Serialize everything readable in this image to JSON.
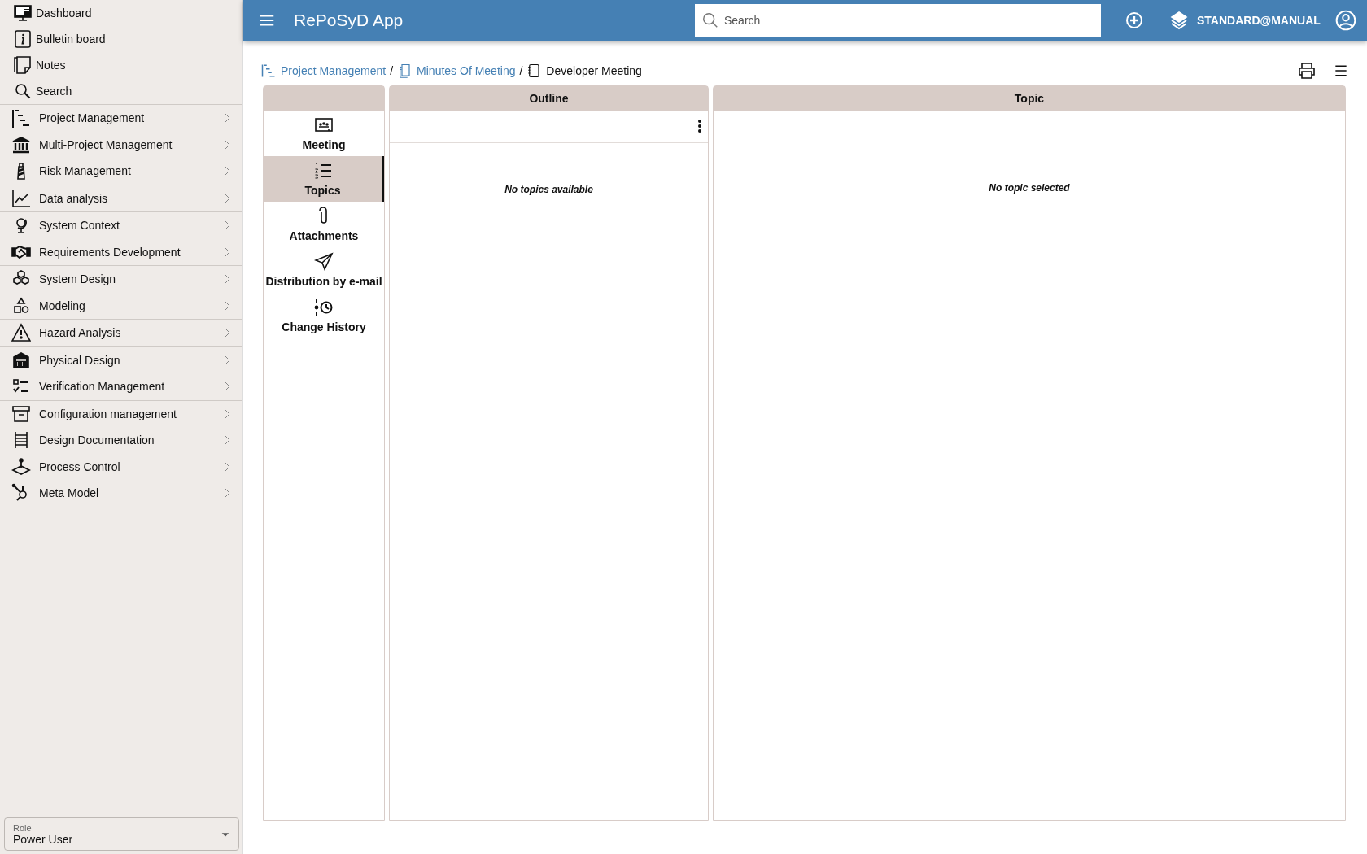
{
  "sidebar": {
    "top_items": [
      {
        "label": "Dashboard"
      },
      {
        "label": "Bulletin board"
      },
      {
        "label": "Notes"
      },
      {
        "label": "Search"
      }
    ],
    "groups": [
      [
        {
          "label": "Project Management"
        },
        {
          "label": "Multi-Project Management"
        },
        {
          "label": "Risk Management"
        }
      ],
      [
        {
          "label": "Data analysis"
        }
      ],
      [
        {
          "label": "System Context"
        },
        {
          "label": "Requirements Development"
        }
      ],
      [
        {
          "label": "System Design"
        },
        {
          "label": "Modeling"
        }
      ],
      [
        {
          "label": "Hazard Analysis"
        }
      ],
      [
        {
          "label": "Physical Design"
        },
        {
          "label": "Verification Management"
        }
      ],
      [
        {
          "label": "Configuration management"
        },
        {
          "label": "Design Documentation"
        },
        {
          "label": "Process Control"
        },
        {
          "label": "Meta Model"
        }
      ]
    ],
    "role_field": {
      "label": "Role",
      "value": "Power User"
    }
  },
  "header": {
    "app_title": "RePoSyD App",
    "search": {
      "placeholder": "Search"
    },
    "user": "STANDARD@MANUAL"
  },
  "breadcrumb_separator": "/",
  "breadcrumb": [
    {
      "label": "Project Management",
      "kind": "link"
    },
    {
      "label": "Minutes Of Meeting",
      "kind": "link"
    },
    {
      "label": "Developer Meeting",
      "kind": "current"
    }
  ],
  "tabs": [
    {
      "label": "Meeting",
      "selected": false
    },
    {
      "label": "Topics",
      "selected": true
    },
    {
      "label": "Attachments",
      "selected": false
    },
    {
      "label": "Distribution by e-mail",
      "selected": false
    },
    {
      "label": "Change History",
      "selected": false
    }
  ],
  "outline": {
    "title": "Outline",
    "empty_text": "No topics available"
  },
  "topic": {
    "title": "Topic",
    "empty_text": "No topic selected"
  }
}
